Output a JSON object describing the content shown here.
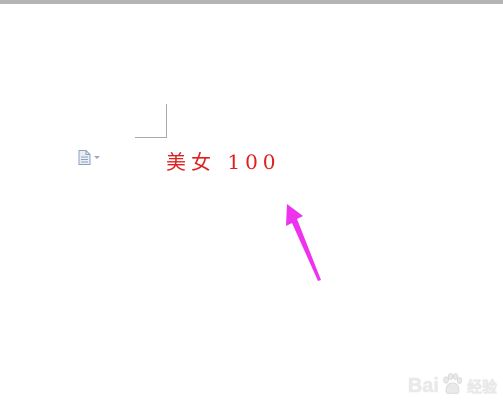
{
  "document": {
    "text": "美女 100",
    "text_color": "#e0201e",
    "paste_options_icon": "paste-options-icon"
  },
  "annotation": {
    "arrow_color": "#ee33ee"
  },
  "watermark": {
    "brand_left": "Bai",
    "brand_right": "经验",
    "paw_icon": "baidu-paw-icon"
  },
  "colors": {
    "page_background": "#ffffff",
    "top_bar": "#b4b4b4",
    "margin_marker": "#a9a9a9"
  }
}
